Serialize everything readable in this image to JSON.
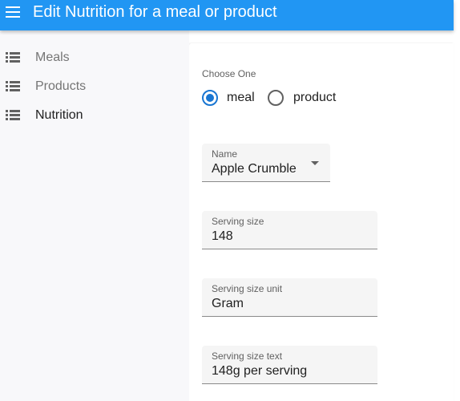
{
  "appbar": {
    "menu_icon": "menu-icon",
    "title": "Edit Nutrition for a meal or product",
    "color": "#2196f3"
  },
  "sidebar": {
    "items": [
      {
        "icon": "list-icon",
        "label": "Meals",
        "active": false
      },
      {
        "icon": "list-icon",
        "label": "Products",
        "active": false
      },
      {
        "icon": "list-icon",
        "label": "Nutrition",
        "active": true
      }
    ]
  },
  "form": {
    "type_group": {
      "legend": "Choose One",
      "options": [
        {
          "label": "meal",
          "checked": true
        },
        {
          "label": "product",
          "checked": false
        }
      ]
    },
    "name": {
      "label": "Name",
      "value": "Apple Crumble"
    },
    "serving_size": {
      "label": "Serving size",
      "value": "148"
    },
    "serving_size_unit": {
      "label": "Serving size unit",
      "value": "Gram"
    },
    "serving_size_text": {
      "label": "Serving size text",
      "value": "148g per serving"
    }
  },
  "colors": {
    "primary": "#2196f3",
    "radio_checked": "#1976d2",
    "sidebar_bg": "#f8f8fa",
    "field_bg": "#f5f5f5"
  }
}
